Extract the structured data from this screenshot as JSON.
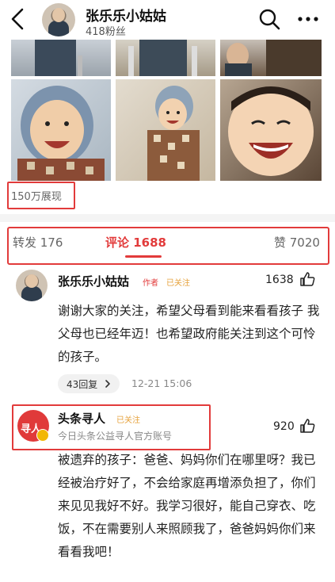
{
  "header": {
    "name": "张乐乐小姑姑",
    "fans": "418粉丝",
    "icons": [
      "back-arrow-icon",
      "search-icon",
      "more-icon"
    ]
  },
  "post": {
    "reach_label": "150万展现"
  },
  "tabs": {
    "repost": "转发 176",
    "comment": "评论 1688",
    "like": "赞 7020"
  },
  "comments": [
    {
      "name": "张乐乐小姑姑",
      "author_tag": "作者",
      "follow_tag": "已关注",
      "like_count": "1638",
      "body": "谢谢大家的关注，希望父母看到能来看看孩子 我父母也已经年迈！也希望政府能关注到这个可怜的孩子。",
      "replies": "43回复",
      "time": "12-21 15:06"
    },
    {
      "name": "头条寻人",
      "follow_tag": "已关注",
      "desc": "今日头条公益寻人官方账号",
      "avatar_text": "寻人",
      "like_count": "920",
      "body": "被遗弃的孩子：爸爸、妈妈你们在哪里呀？我已经被治疗好了，不会给家庭再增添负担了，你们来见见我好不好。我学习很好，能自己穿衣、吃饭，不在需要别人来照顾我了，爸爸妈妈你们来看看我吧！"
    }
  ],
  "colors": {
    "accent_red": "#e23b3b",
    "follow_orange": "#e6a23c"
  }
}
